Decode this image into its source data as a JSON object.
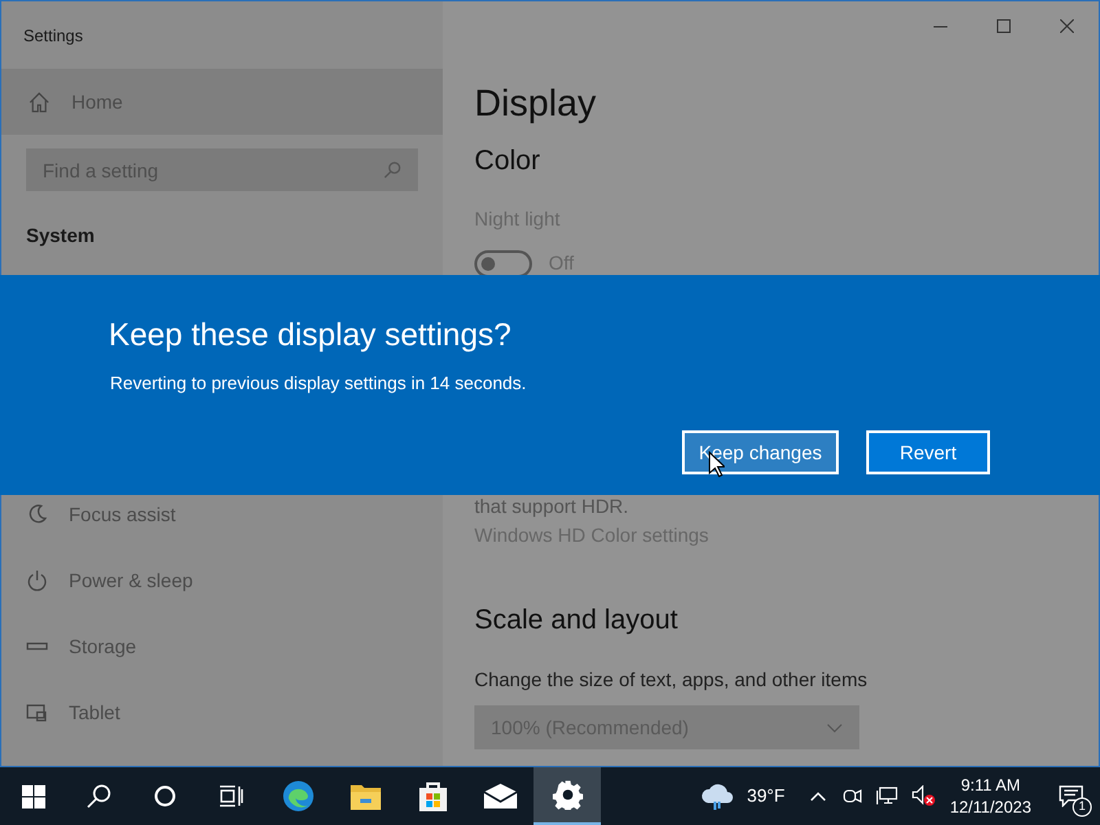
{
  "window": {
    "title": "Settings"
  },
  "sidebar": {
    "home": "Home",
    "search": {
      "placeholder": "Find a setting"
    },
    "section": "System",
    "items": [
      {
        "label": "Focus assist"
      },
      {
        "label": "Power & sleep"
      },
      {
        "label": "Storage"
      },
      {
        "label": "Tablet"
      }
    ]
  },
  "main": {
    "title": "Display",
    "color_heading": "Color",
    "night_light": {
      "label": "Night light",
      "on": false,
      "state_text": "Off"
    },
    "hdr_text": "that support HDR.",
    "hdr_link": "Windows HD Color settings",
    "scale_heading": "Scale and layout",
    "scale_label": "Change the size of text, apps, and other items",
    "scale_dropdown": {
      "value": "100% (Recommended)"
    }
  },
  "dialog": {
    "title": "Keep these display settings?",
    "message": "Reverting to previous display settings in 14 seconds.",
    "buttons": [
      {
        "label": "Keep changes",
        "hovered": true
      },
      {
        "label": "Revert",
        "hovered": false
      }
    ]
  },
  "taskbar": {
    "apps": [
      {
        "active": false
      },
      {
        "active": false
      },
      {
        "active": false
      },
      {
        "active": false
      },
      {
        "active": true
      }
    ],
    "weather": "39°F",
    "time": "9:11 AM",
    "date": "12/11/2023",
    "notification_count": "1"
  }
}
